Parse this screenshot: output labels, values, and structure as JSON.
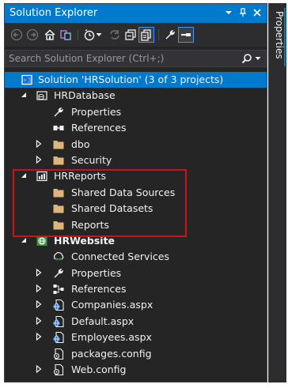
{
  "window": {
    "title": "Solution Explorer",
    "side_tab_label": "Properties"
  },
  "search": {
    "placeholder": "Search Solution Explorer (Ctrl+;)"
  },
  "tree": {
    "solution_label": "Solution 'HRSolution' (3 of 3 projects)",
    "hrdatabase": {
      "label": "HRDatabase",
      "children": [
        "Properties",
        "References",
        "dbo",
        "Security"
      ]
    },
    "hrreports": {
      "label": "HRReports",
      "children": [
        "Shared Data Sources",
        "Shared Datasets",
        "Reports"
      ]
    },
    "hrwebsite": {
      "label": "HRWebsite",
      "children": [
        "Connected Services",
        "Properties",
        "References",
        "Companies.aspx",
        "Default.aspx",
        "Employees.aspx",
        "packages.config",
        "Web.config"
      ]
    }
  },
  "colors": {
    "accent": "#007acc",
    "panel_bg": "#252526",
    "folder": "#dcb67a",
    "highlight_border": "#d0101a"
  }
}
